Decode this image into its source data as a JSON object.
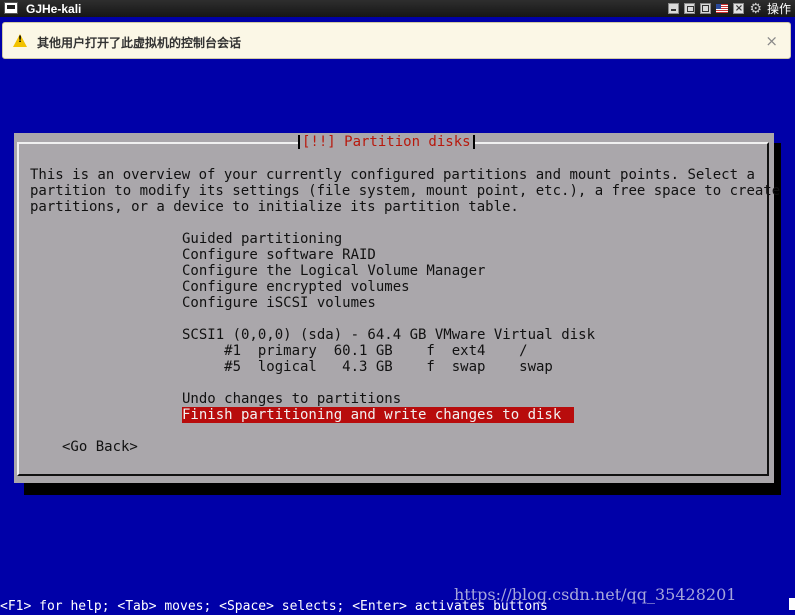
{
  "window": {
    "title": "GJHe-kali",
    "ops_label": "操作"
  },
  "notification": {
    "message": "其他用户打开了此虚拟机的控制台会话",
    "close_glyph": "×"
  },
  "dialog": {
    "title": "[!!] Partition disks",
    "intro": [
      "This is an overview of your currently configured partitions and mount points. Select a",
      "partition to modify its settings (file system, mount point, etc.), a free space to create",
      "partitions, or a device to initialize its partition table."
    ],
    "menu": [
      "Guided partitioning",
      "Configure software RAID",
      "Configure the Logical Volume Manager",
      "Configure encrypted volumes",
      "Configure iSCSI volumes"
    ],
    "disk": "SCSI1 (0,0,0) (sda) - 64.4 GB VMware Virtual disk",
    "partitions": [
      "     #1  primary  60.1 GB    f  ext4    /",
      "     #5  logical   4.3 GB    f  swap    swap"
    ],
    "undo": "Undo changes to partitions",
    "finish": "Finish partitioning and write changes to disk",
    "go_back": "<Go Back>"
  },
  "footer": {
    "help": "<F1> for help; <Tab> moves; <Space> selects; <Enter> activates buttons",
    "watermark": "https://blog.csdn.net/qq_35428201"
  },
  "colors": {
    "background": "#0000a8",
    "dialog": "#aaa7ab",
    "title_text": "#b8180c",
    "selection": "#b80c0c"
  }
}
